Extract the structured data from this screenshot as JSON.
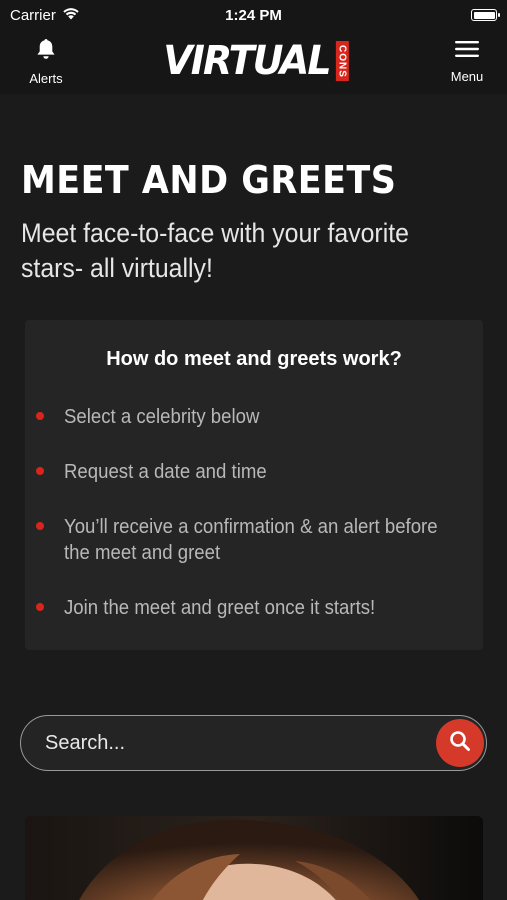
{
  "status_bar": {
    "carrier": "Carrier",
    "time": "1:24 PM"
  },
  "nav": {
    "alerts_label": "Alerts",
    "menu_label": "Menu",
    "logo_main": "VIRTUAL",
    "logo_sub": "CONS"
  },
  "page": {
    "title": "MEET AND GREETS",
    "subtitle": "Meet face-to-face with your favorite stars- all virtually!"
  },
  "info": {
    "title": "How do meet and greets work?",
    "steps": [
      "Select a celebrity below",
      "Request a date and time",
      "You’ll receive a confirmation & an alert before the meet and greet",
      "Join the meet and greet once it starts!"
    ]
  },
  "search": {
    "placeholder": "Search..."
  },
  "colors": {
    "accent": "#d9261c",
    "background": "#1b1b1b",
    "card": "#252525"
  },
  "icons": [
    "wifi-icon",
    "battery-icon",
    "bell-icon",
    "hamburger-menu-icon",
    "search-icon"
  ]
}
